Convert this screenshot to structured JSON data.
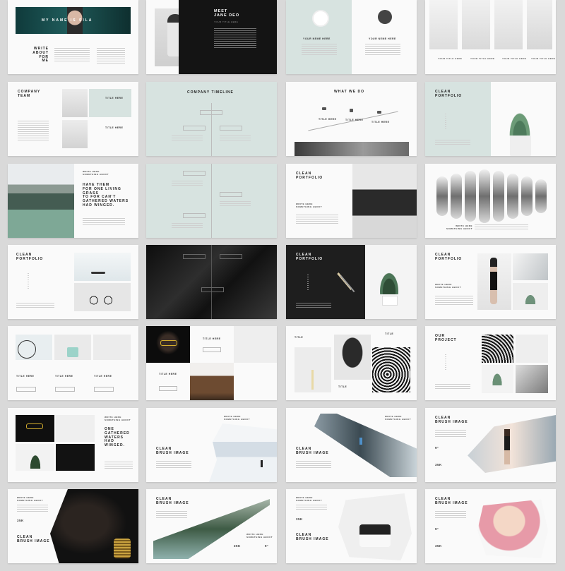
{
  "slides": {
    "s1": {
      "banner": "MY NAME IS SILA",
      "title": "WRITE\nABOUT FOR\nME"
    },
    "s2": {
      "title": "MEET\nJANE DEO",
      "sub": "YOUR TITLE HERE"
    },
    "s3": {
      "name1": "YOUR NEME HERE",
      "name2": "YOUR NEME HERE"
    },
    "s4": {
      "captions": [
        "YOUR TITLE HERE",
        "YOUR TITLE HERE",
        "YOUR TITLE HERE",
        "YOUR TITLE HERE"
      ]
    },
    "s5": {
      "title": "COMPANY\nTEAM",
      "label1": "TITLE HERE",
      "label2": "TITLE HERE"
    },
    "s6": {
      "title": "COMPANY TIMELINE"
    },
    "s7": {
      "title": "WHAT WE DO",
      "label1": "TITLE HERE",
      "label2": "TITLE HERE",
      "label3": "TITLE HERE"
    },
    "s8": {
      "title": "CLEAN\nPORTFOLIO"
    },
    "s9": {
      "kicker": "WRITE HERE\nSOMETHING ABOUT",
      "quote": "HAVE THEM\nFOR ONE LIVING GRASS\nTO FOR CAN'T\nGATHERED WATERS\nHAD WINGED."
    },
    "s11": {
      "title": "CLEAN\nPORTFOLIO",
      "kicker": "WRITE HERE\nSOMETHING ABOUT"
    },
    "s12": {
      "kicker": "WRITE HERE\nSOMETHING ABOUT"
    },
    "s13": {
      "title": "CLEAN\nPORTFOLIO"
    },
    "s15": {
      "title": "CLEAN\nPORTFOLIO"
    },
    "s16": {
      "title": "CLEAN\nPORTFOLIO",
      "kicker": "WRITE HERE\nSOMETHING ABOUT"
    },
    "s17": {
      "labels": [
        "TITLE HERE",
        "TITLE HERE",
        "TITLE HERE"
      ]
    },
    "s18": {
      "label1": "TITLE HERE",
      "label2": "TITLE HERE"
    },
    "s19": {
      "label1": "TITLE",
      "label2": "TITLE",
      "label3": "TITLE"
    },
    "s20": {
      "title": "OUR\nPROJECT"
    },
    "s21": {
      "kicker": "WRITE HERE\nSOMETHING ABOUT",
      "quote": "ONE\nGATHERED\nWATERS\nHAD\nWINGED."
    },
    "s22": {
      "title": "CLEAN\nBRUSH IMAGE",
      "kicker": "WRITE HERE\nSOMETHING ABOUT"
    },
    "s23": {
      "title": "CLEAN\nBRUSH IMAGE",
      "kicker": "WRITE HERE\nSOMETHING ABOUT"
    },
    "s24": {
      "title": "CLEAN\nBRUSH IMAGE",
      "stat1": "9°",
      "stat2": "35K"
    },
    "s25": {
      "kicker": "WRITE HERE\nSOMETHING ABOUT",
      "stat": "35K",
      "title": "CLEAN\nBRUSH IMAGE"
    },
    "s26": {
      "title": "CLEAN\nBRUSH IMAGE",
      "kicker": "WRITE HERE\nSOMETHING ABOUT",
      "stat1": "35K",
      "stat2": "9°"
    },
    "s27": {
      "kicker": "WRITE HERE\nSOMETHING ABOUT",
      "stat": "35K",
      "title": "CLEAN\nBRUSH IMAGE"
    },
    "s28": {
      "title": "CLEAN\nBRUSH IMAGE",
      "stat1": "9°",
      "stat2": "35K"
    }
  },
  "colors": {
    "mint": "#d7e3e0",
    "dark": "#1b1b1b",
    "paper": "#fafafa",
    "background": "#d9d9d9"
  }
}
